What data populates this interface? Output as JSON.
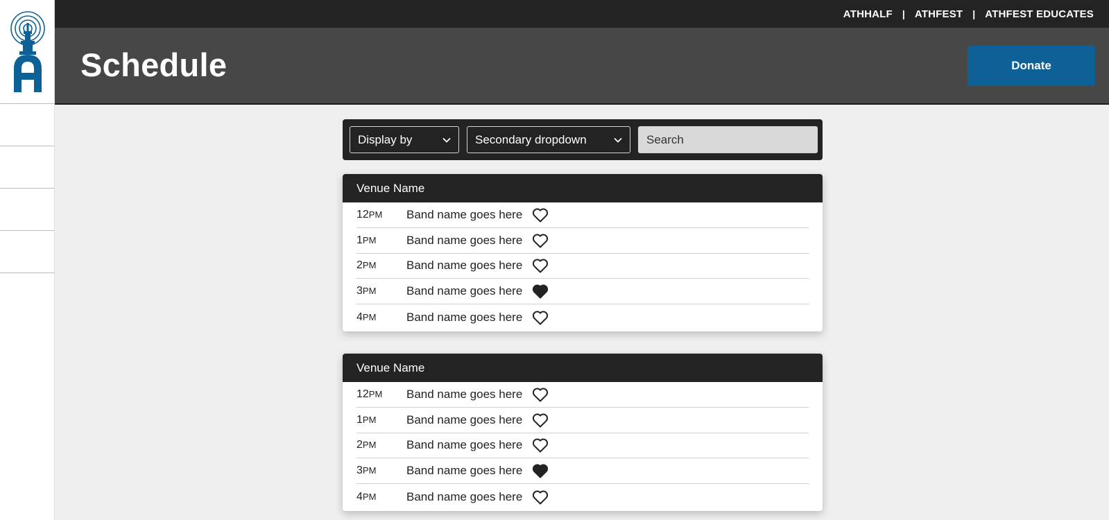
{
  "colors": {
    "accent": "#0e6196",
    "dark_bar": "#232323",
    "header_bg": "#474747",
    "page_bg": "#efefef"
  },
  "logo": {
    "icon": "athfest-tower-logo-icon"
  },
  "top_nav": {
    "links": [
      "ATHHALF",
      "ATHFEST",
      "ATHFEST EDUCATES"
    ],
    "separator": "|"
  },
  "header": {
    "title": "Schedule",
    "donate_label": "Donate"
  },
  "filters": {
    "display_by": {
      "selected": "Display by",
      "icon": "chevron-down-icon"
    },
    "secondary": {
      "selected": "Secondary dropdown",
      "icon": "chevron-down-icon"
    },
    "search": {
      "placeholder": "Search",
      "value": ""
    }
  },
  "venues": [
    {
      "name": "Venue Name",
      "slots": [
        {
          "hour": "12",
          "meridiem": "PM",
          "band": "Band name goes here",
          "favorited": false
        },
        {
          "hour": "1",
          "meridiem": "PM",
          "band": "Band name goes here",
          "favorited": false
        },
        {
          "hour": "2",
          "meridiem": "PM",
          "band": "Band name goes here",
          "favorited": false
        },
        {
          "hour": "3",
          "meridiem": "PM",
          "band": "Band name goes here",
          "favorited": true
        },
        {
          "hour": "4",
          "meridiem": "PM",
          "band": "Band name goes here",
          "favorited": false
        }
      ]
    },
    {
      "name": "Venue Name",
      "slots": [
        {
          "hour": "12",
          "meridiem": "PM",
          "band": "Band name goes here",
          "favorited": false
        },
        {
          "hour": "1",
          "meridiem": "PM",
          "band": "Band name goes here",
          "favorited": false
        },
        {
          "hour": "2",
          "meridiem": "PM",
          "band": "Band name goes here",
          "favorited": false
        },
        {
          "hour": "3",
          "meridiem": "PM",
          "band": "Band name goes here",
          "favorited": true
        },
        {
          "hour": "4",
          "meridiem": "PM",
          "band": "Band name goes here",
          "favorited": false
        }
      ]
    }
  ]
}
